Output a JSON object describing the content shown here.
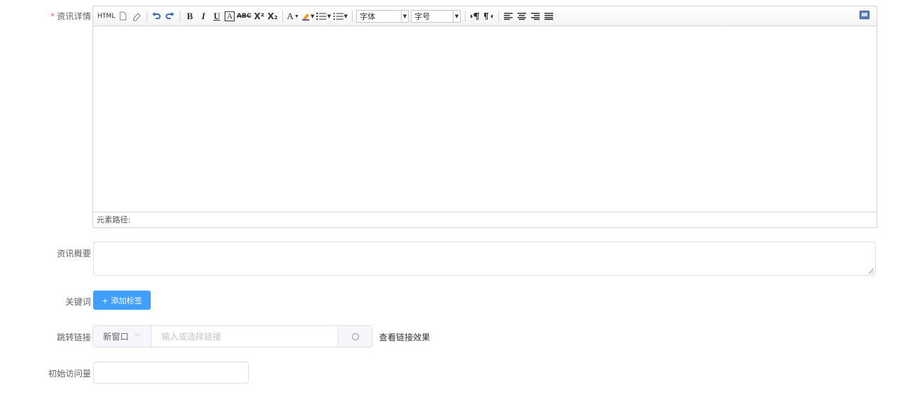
{
  "form": {
    "detail": {
      "required_mark": "*",
      "label": "资讯详情"
    },
    "summary": {
      "label": "资讯概要",
      "value": ""
    },
    "keywords": {
      "label": "关键词",
      "add_tag_label": "+ 添加标签"
    },
    "jump_link": {
      "label": "跳转链接",
      "window_option": "新窗口",
      "placeholder": "输入或选择链接",
      "view_effect_label": "查看链接效果"
    },
    "initial_visits": {
      "label": "初始访问量",
      "value": ""
    }
  },
  "editor": {
    "toolbar": {
      "html_label": "HTML",
      "bold_label": "B",
      "italic_label": "I",
      "underline_label": "U",
      "font_border_label": "A",
      "strike_label": "ABC",
      "superscript_label": "X²",
      "subscript_label": "X₂",
      "font_color_label": "A",
      "font_family_label": "字体",
      "font_size_label": "字号"
    },
    "status_label": "元素路径:"
  }
}
